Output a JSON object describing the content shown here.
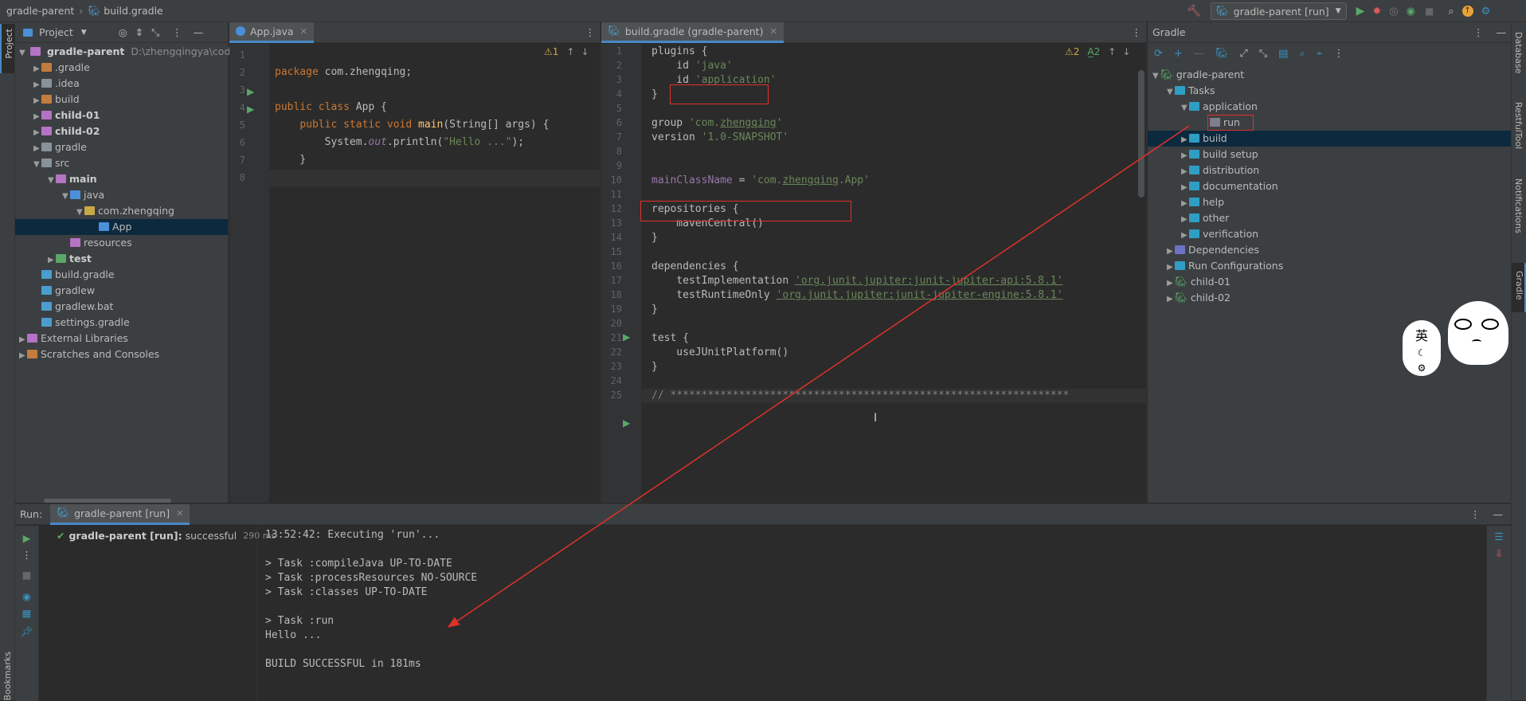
{
  "topbar": {
    "project": "gradle-parent",
    "file": "build.gradle",
    "run_config": "gradle-parent [run]"
  },
  "left_strip": {
    "project": "Project",
    "bookmarks": "Bookmarks"
  },
  "right_strip": {
    "database": "Database",
    "restful": "RestfulTool",
    "notifications": "Notifications",
    "gradle": "Gradle"
  },
  "project_panel": {
    "title": "Project",
    "root_name": "gradle-parent",
    "root_path": "D:\\zhengqingya\\code\\v",
    "items": [
      {
        "label": ".gradle",
        "depth": 1,
        "arrow": "▶",
        "kind": "folder-orange",
        "bold": false
      },
      {
        "label": ".idea",
        "depth": 1,
        "arrow": "▶",
        "kind": "folder",
        "bold": false
      },
      {
        "label": "build",
        "depth": 1,
        "arrow": "▶",
        "kind": "folder-orange",
        "bold": false
      },
      {
        "label": "child-01",
        "depth": 1,
        "arrow": "▶",
        "kind": "module",
        "bold": true
      },
      {
        "label": "child-02",
        "depth": 1,
        "arrow": "▶",
        "kind": "module",
        "bold": true
      },
      {
        "label": "gradle",
        "depth": 1,
        "arrow": "▶",
        "kind": "folder",
        "bold": false
      },
      {
        "label": "src",
        "depth": 1,
        "arrow": "▼",
        "kind": "folder",
        "bold": false
      },
      {
        "label": "main",
        "depth": 2,
        "arrow": "▼",
        "kind": "module",
        "bold": true
      },
      {
        "label": "java",
        "depth": 3,
        "arrow": "▼",
        "kind": "source",
        "bold": false
      },
      {
        "label": "com.zhengqing",
        "depth": 4,
        "arrow": "▼",
        "kind": "package",
        "bold": false
      },
      {
        "label": "App",
        "depth": 5,
        "arrow": "",
        "kind": "class",
        "bold": false,
        "selected": true
      },
      {
        "label": "resources",
        "depth": 3,
        "arrow": "",
        "kind": "resources",
        "bold": false
      },
      {
        "label": "test",
        "depth": 2,
        "arrow": "▶",
        "kind": "test",
        "bold": true
      },
      {
        "label": "build.gradle",
        "depth": 1,
        "arrow": "",
        "kind": "gradle",
        "bold": false
      },
      {
        "label": "gradlew",
        "depth": 1,
        "arrow": "",
        "kind": "gradle",
        "bold": false
      },
      {
        "label": "gradlew.bat",
        "depth": 1,
        "arrow": "",
        "kind": "gradle",
        "bold": false
      },
      {
        "label": "settings.gradle",
        "depth": 1,
        "arrow": "",
        "kind": "gradle",
        "bold": false
      },
      {
        "label": "External Libraries",
        "depth": 0,
        "arrow": "▶",
        "kind": "library",
        "bold": false
      },
      {
        "label": "Scratches and Consoles",
        "depth": 0,
        "arrow": "▶",
        "kind": "scratch",
        "bold": false
      }
    ]
  },
  "java_editor": {
    "tab": "App.java",
    "inspection": "⚠1",
    "lines": [
      "1",
      "2",
      "3",
      "4",
      "5",
      "6",
      "7",
      "8"
    ]
  },
  "gradle_editor": {
    "tab": "build.gradle (gradle-parent)",
    "inspection_warn": "⚠2",
    "inspection_typo": "A̲2",
    "lines": [
      "1",
      "2",
      "3",
      "4",
      "5",
      "6",
      "7",
      "8",
      "9",
      "10",
      "11",
      "12",
      "13",
      "14",
      "15",
      "16",
      "17",
      "18",
      "19",
      "20",
      "21",
      "22",
      "23",
      "24",
      "25"
    ]
  },
  "gradle_panel": {
    "title": "Gradle",
    "root": "gradle-parent",
    "tasks": "Tasks",
    "application": "application",
    "run": "run",
    "groups": [
      "build",
      "build setup",
      "distribution",
      "documentation",
      "help",
      "other",
      "verification"
    ],
    "dependencies": "Dependencies",
    "run_configurations": "Run Configurations",
    "modules": [
      "child-01",
      "child-02"
    ]
  },
  "sticker": {
    "text": "英"
  },
  "run_panel": {
    "label": "Run:",
    "tab": "gradle-parent [run]",
    "status_name": "gradle-parent [run]:",
    "status": "successful",
    "duration": "290 ms",
    "console": [
      "13:52:42: Executing 'run'...",
      "",
      "> Task :compileJava UP-TO-DATE",
      "> Task :processResources NO-SOURCE",
      "> Task :classes UP-TO-DATE",
      "",
      "> Task :run",
      "Hello ...",
      "",
      "BUILD SUCCESSFUL in 181ms"
    ]
  },
  "colors": {
    "annotation": "#e0312b",
    "keyword": "#cc7832",
    "string": "#6a8759",
    "function": "#ffc66d",
    "selection": "#0d293e"
  }
}
